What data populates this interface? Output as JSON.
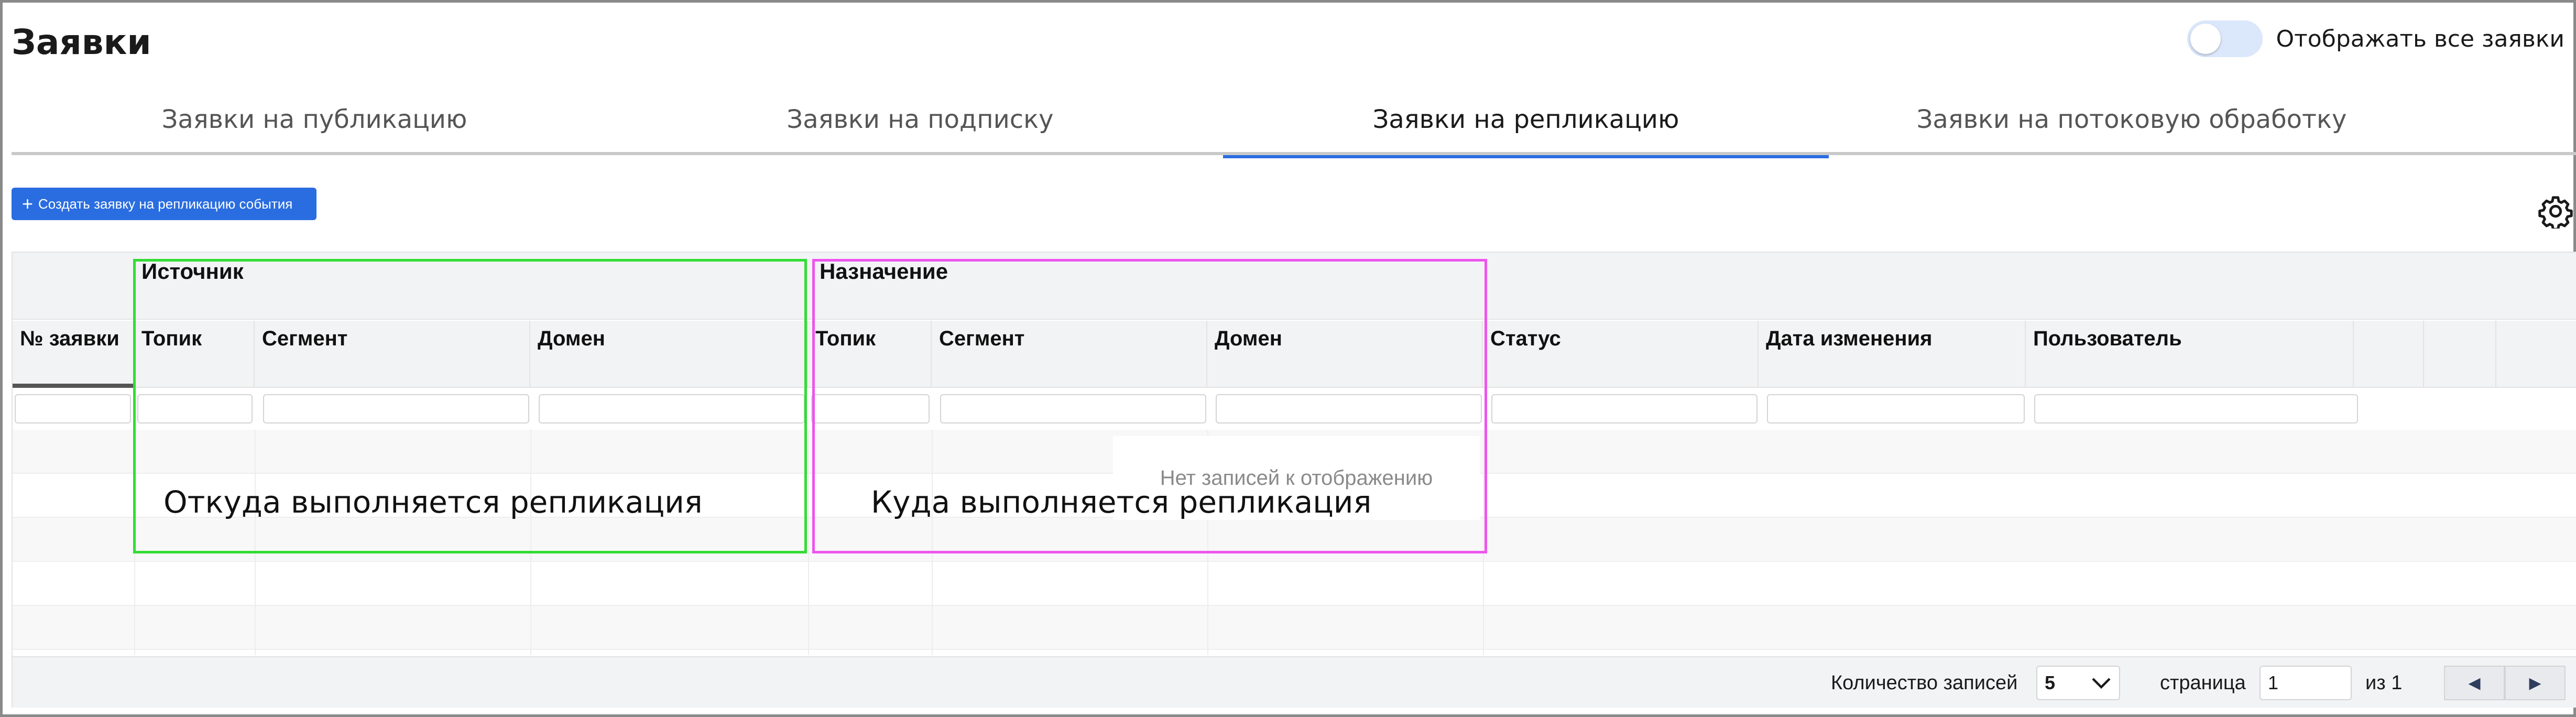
{
  "header": {
    "title": "Заявки",
    "toggle_label": "Отображать все заявки",
    "toggle_on": false
  },
  "tabs": [
    {
      "label": "Заявки на публикацию",
      "active": false
    },
    {
      "label": "Заявки на подписку",
      "active": false
    },
    {
      "label": "Заявки на репликацию",
      "active": true
    },
    {
      "label": "Заявки на потоковую обработку",
      "active": false
    }
  ],
  "toolbar": {
    "create_label": "Создать заявку на репликацию события",
    "plus": "+"
  },
  "grid": {
    "groups": {
      "source": "Источник",
      "destination": "Назначение"
    },
    "columns": {
      "number": "№ заявки",
      "src_topic": "Топик",
      "src_segment": "Сегмент",
      "src_domain": "Домен",
      "dst_topic": "Топик",
      "dst_segment": "Сегмент",
      "dst_domain": "Домен",
      "status": "Статус",
      "changed": "Дата изменения",
      "user": "Пользователь"
    },
    "empty_message": "Нет записей к отображению"
  },
  "footer": {
    "records_label": "Количество записей",
    "records_value": "5",
    "page_label": "страница",
    "page_value": "1",
    "of_label": "из 1",
    "prev": "◀",
    "next": "▶"
  },
  "annotations": {
    "source_text": "Откуда выполняется репликация",
    "destination_text": "Куда выполняется репликация",
    "source_color": "#33dd33",
    "destination_color": "#ee55ee"
  },
  "colors": {
    "accent": "#2a6de0"
  }
}
